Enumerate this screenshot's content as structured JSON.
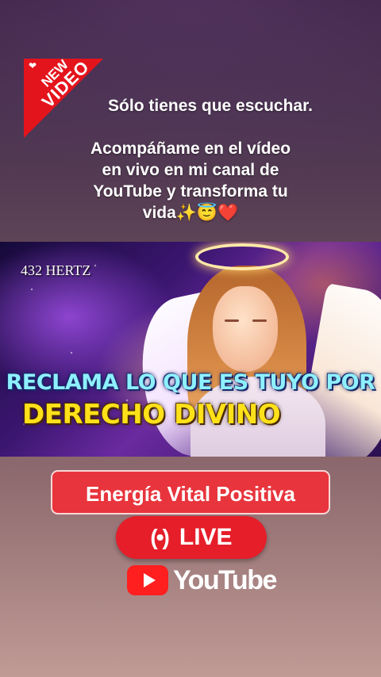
{
  "badge": {
    "line1": "NEW",
    "line2": "VIDEO",
    "heart": "❤"
  },
  "message": {
    "line1": "Sólo tienes que escuchar.",
    "lines": [
      "Acompáñame en el vídeo",
      "en vivo en mi canal de",
      "YouTube y transforma tu",
      "vida✨😇❤️"
    ]
  },
  "thumbnail": {
    "tag": "432 HERTZ",
    "headline1": "RECLAMA LO QUE ES TUYO POR",
    "headline2": "DERECHO DIVINO"
  },
  "channel_button": {
    "label": "Energía Vital Positiva"
  },
  "live_button": {
    "label": "LIVE",
    "icon": "broadcast-icon"
  },
  "youtube": {
    "label": "YouTube",
    "icon": "youtube-play-icon"
  },
  "colors": {
    "badge_red": "#e4141c",
    "channel_red": "#e8343c",
    "live_red": "#e51e2a",
    "headline_cyan": "#8ef0ff",
    "headline_yellow": "#ffe11a"
  }
}
